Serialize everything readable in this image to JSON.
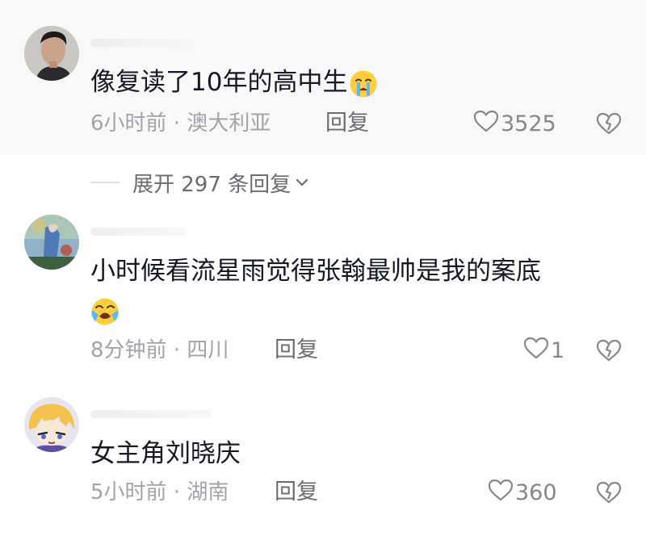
{
  "comments": [
    {
      "text": "像复读了10年的高中生",
      "emoji": "crying-face-emoji",
      "meta": "6小时前 · 澳大利亚",
      "reply_label": "回复",
      "likes": "3525",
      "expand_label": "展开 297 条回复"
    },
    {
      "text_line1": "小时候看流星雨觉得张翰最帅是我的案底",
      "emoji": "loudly-crying-face-emoji",
      "meta": "8分钟前 · 四川",
      "reply_label": "回复",
      "likes": "1"
    },
    {
      "text": "女主角刘晓庆",
      "meta": "5小时前 · 湖南",
      "reply_label": "回复",
      "likes": "360"
    }
  ],
  "icons": {
    "like": "heart-outline-icon",
    "dislike": "broken-heart-outline-icon",
    "expand": "chevron-down-icon"
  },
  "colors": {
    "text_primary": "#161823",
    "text_meta": "#a3a3a8",
    "highlight_bg": "#f8f8f8"
  }
}
